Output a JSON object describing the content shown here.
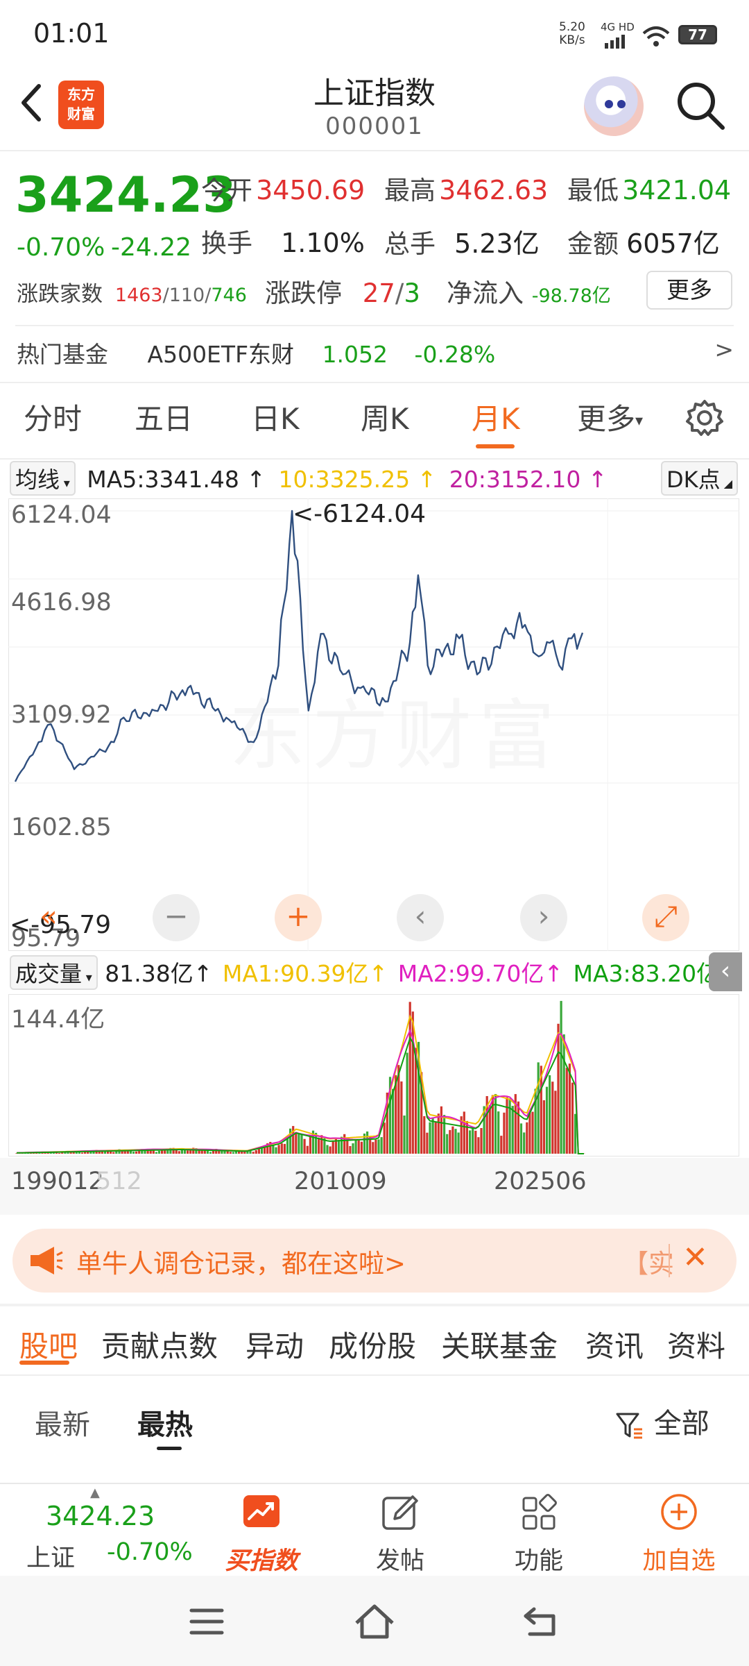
{
  "status_bar": {
    "time": "01:01",
    "net_speed": "5.20",
    "net_unit": "KB/s",
    "network": "4G HD",
    "battery": "77"
  },
  "header": {
    "logo_line1": "东方",
    "logo_line2": "财富",
    "title": "上证指数",
    "code": "000001"
  },
  "quote": {
    "price": "3424.23",
    "change_pct": "-0.70%",
    "change_val": "-24.22",
    "open_label": "今开",
    "open": "3450.69",
    "high_label": "最高",
    "high": "3462.63",
    "low_label": "最低",
    "low": "3421.04",
    "turnover_label": "换手",
    "turnover": "1.10%",
    "volume_label": "总手",
    "volume": "5.23亿",
    "amount_label": "金额",
    "amount": "6057亿",
    "breadth_label": "涨跌家数",
    "breadth_up": "1463",
    "breadth_flat": "110",
    "breadth_down": "746",
    "limit_label": "涨跌停",
    "limit_up": "27",
    "limit_down": "3",
    "netflow_label": "净流入",
    "netflow": "-98.78亿",
    "more": "更多",
    "fund_label": "热门基金",
    "fund_name": "A500ETF东财",
    "fund_price": "1.052",
    "fund_change": "-0.28%",
    "fund_arrow": ">"
  },
  "period_tabs": [
    "分时",
    "五日",
    "日K",
    "周K",
    "月K",
    "更多"
  ],
  "active_period": "月K",
  "ma_row": {
    "selector": "均线",
    "ma5": "MA5:3341.48",
    "ma10": "10:3325.25",
    "ma20": "20:3152.10",
    "dk": "DK点"
  },
  "colors": {
    "up": "#e03030",
    "down": "#1aa01a",
    "accent": "#f26a20",
    "ma1": "#f0c000",
    "ma2": "#e020c0",
    "ma3": "#10a010",
    "price_line": "#2f4f7f"
  },
  "chart": {
    "y_ticks": [
      "6124.04",
      "4616.98",
      "3109.92",
      "1602.85",
      "95.79"
    ],
    "max_label": "<-6124.04",
    "min_label": "<-95.79",
    "watermark": "东方财富",
    "controls": [
      "«",
      "−",
      "+",
      "‹",
      "›",
      "⤢"
    ]
  },
  "volume": {
    "selector": "成交量",
    "current": "81.38亿",
    "ma1": "MA1:90.39亿",
    "ma2": "MA2:99.70亿",
    "ma3": "MA3:83.20亿",
    "max_label": "144.4亿",
    "collapse": "‹"
  },
  "x_axis": {
    "labels": [
      "199012",
      "201009",
      "202506"
    ],
    "ghost": "512"
  },
  "chart_data": {
    "type": "line",
    "title": "上证指数 月K",
    "x_range": [
      "199012",
      "202506"
    ],
    "ylim": [
      95.79,
      6124.04
    ],
    "y_ticks": [
      95.79,
      1602.85,
      3109.92,
      4616.98,
      6124.04
    ],
    "series": [
      {
        "name": "close",
        "x": [
          "1990-12",
          "1992-05",
          "1993-02",
          "1994-07",
          "1996-12",
          "1997-05",
          "1999-06",
          "2001-06",
          "2003-12",
          "2005-06",
          "2006-12",
          "2007-10",
          "2008-10",
          "2009-07",
          "2010-09",
          "2011-12",
          "2013-06",
          "2014-12",
          "2015-06",
          "2016-01",
          "2017-12",
          "2019-01",
          "2020-12",
          "2021-12",
          "2022-10",
          "2023-06",
          "2024-01",
          "2024-10",
          "2025-06"
        ],
        "y": [
          127,
          1000,
          1400,
          400,
          1000,
          1500,
          1700,
          2200,
          1500,
          1000,
          2700,
          6124,
          1700,
          3400,
          2600,
          2200,
          1900,
          3200,
          4700,
          2700,
          3300,
          2500,
          3400,
          3600,
          2900,
          3200,
          2700,
          3300,
          3424
        ]
      }
    ],
    "annotations": [
      "<-6124.04",
      "<-95.79"
    ],
    "volume_series": {
      "name": "成交量",
      "unit": "亿",
      "ymax": 144.4,
      "x": [
        "1990",
        "1996",
        "2001",
        "2005",
        "2007",
        "2008",
        "2010",
        "2013",
        "2015",
        "2016",
        "2019",
        "2020",
        "2021",
        "2022",
        "2024",
        "2025"
      ],
      "y": [
        0.5,
        3,
        5,
        3,
        12,
        25,
        15,
        18,
        144,
        40,
        30,
        60,
        55,
        40,
        125,
        81.38
      ]
    },
    "volume_ma": {
      "MA1": 90.39,
      "MA2": 99.7,
      "MA3": 83.2
    },
    "grid": true
  },
  "banner": {
    "text": "单牛人调仓记录，都在这啦>",
    "tag": "【实",
    "close": "✕"
  },
  "content_tabs": [
    "股吧",
    "贡献点数",
    "异动",
    "成份股",
    "关联基金",
    "资讯",
    "资料"
  ],
  "sub_tabs": {
    "newest": "最新",
    "hot": "最热",
    "filter": "全部"
  },
  "bottom_bar": {
    "price": "3424.23",
    "label": "上证",
    "change": "-0.70%",
    "buy": "买指数",
    "post": "发帖",
    "functions": "功能",
    "watch": "加自选"
  }
}
